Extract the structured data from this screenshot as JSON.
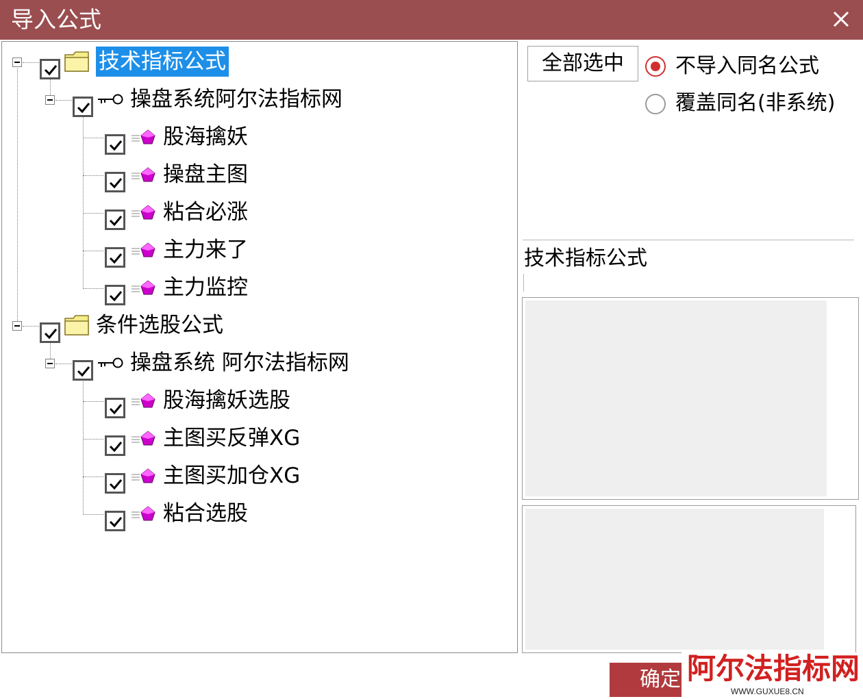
{
  "window": {
    "title": "导入公式",
    "close_icon": "close-icon"
  },
  "tree": {
    "groups": [
      {
        "label": "技术指标公式",
        "checked": true,
        "selected": true,
        "icon": "folder-icon",
        "system": {
          "label": "操盘系统阿尔法指标网",
          "icon": "key-icon",
          "checked": true,
          "items": [
            "股海擒妖",
            "操盘主图",
            "粘合必涨",
            "主力来了",
            "主力监控"
          ]
        }
      },
      {
        "label": "条件选股公式",
        "checked": true,
        "selected": false,
        "icon": "folder-icon",
        "system": {
          "label": "操盘系统 阿尔法指标网",
          "icon": "key-icon",
          "checked": true,
          "items": [
            "股海擒妖选股",
            "主图买反弹XG",
            "主图买加仓XG",
            "粘合选股"
          ]
        }
      }
    ]
  },
  "options": {
    "select_all_label": "全部选中",
    "radios": [
      {
        "label": "不导入同名公式",
        "selected": true
      },
      {
        "label": "覆盖同名(非系统)",
        "selected": false
      }
    ]
  },
  "info": {
    "category_label": "技术指标公式"
  },
  "footer": {
    "ok_label": "确定"
  },
  "watermark": {
    "text": "阿尔法指标网",
    "url": "WWW.GUXUE8.CN"
  },
  "colors": {
    "titlebar": "#9a4e50",
    "selection": "#1e8fe8",
    "ok_button": "#b03a3d",
    "radio_on": "#d03030",
    "watermark": "#d22020",
    "formula_icon": "#cc00cc"
  }
}
